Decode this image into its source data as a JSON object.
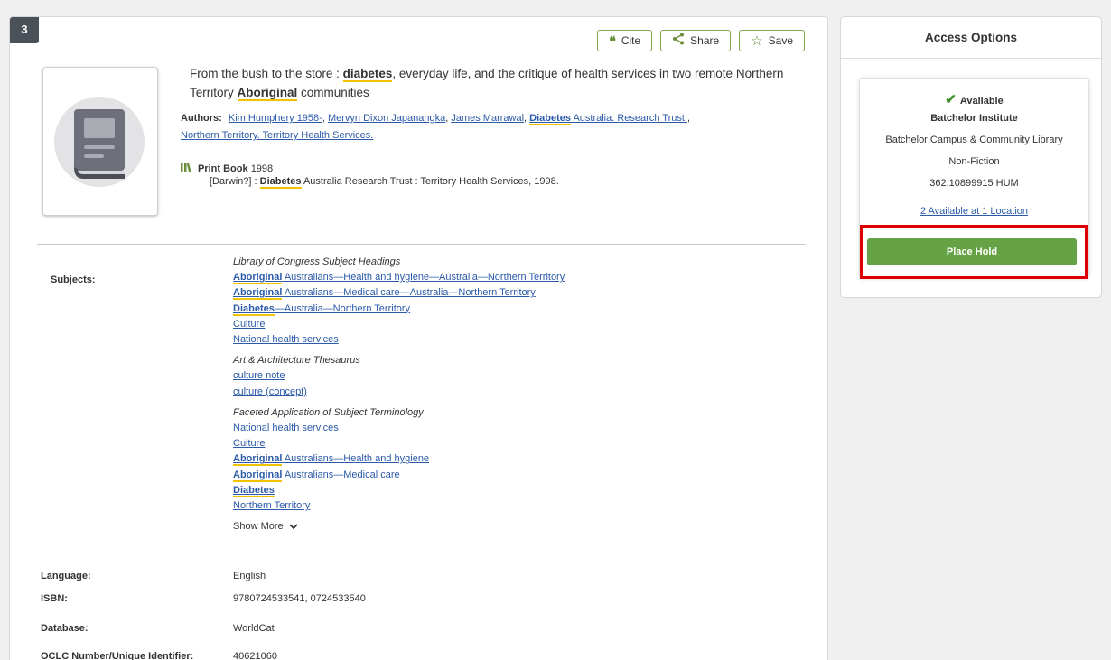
{
  "record": {
    "number": "3",
    "actions": {
      "cite": "Cite",
      "share": "Share",
      "save": "Save"
    },
    "title_parts": [
      "From the bush to the store : ",
      "diabetes",
      ", everyday life, and the critique of health services in two remote Northern Territory ",
      "Aboriginal",
      " communities"
    ],
    "authors_label": "Authors:",
    "authors": [
      "Kim Humphery 1958-",
      "Mervyn Dixon Japanangka",
      "James Marrawal"
    ],
    "author4_hl": "Diabetes",
    "author4_rest": " Australia. Research Trust.",
    "author5": "Northern Territory. Territory Health Services.",
    "format": "Print Book",
    "year": "1998",
    "publisher_pre": "[Darwin?] : ",
    "publisher_hl": "Diabetes",
    "publisher_post": " Australia Research Trust : Territory Health Services, 1998."
  },
  "details": {
    "subjects_label": "Subjects:",
    "lcsh": {
      "heading": "Library of Congress Subject Headings",
      "items": [
        {
          "hl": "Aboriginal",
          "rest": " Australians—Health and hygiene—Australia—Northern Territory"
        },
        {
          "hl": "Aboriginal",
          "rest": " Australians—Medical care—Australia—Northern Territory"
        },
        {
          "hl": "Diabetes",
          "rest": "—Australia—Northern Territory"
        },
        {
          "hl": "",
          "rest": "Culture"
        },
        {
          "hl": "",
          "rest": "National health services"
        }
      ]
    },
    "aat": {
      "heading": "Art & Architecture Thesaurus",
      "items": [
        "culture note",
        "culture (concept)"
      ]
    },
    "fast": {
      "heading": "Faceted Application of Subject Terminology",
      "items": [
        {
          "hl": "",
          "rest": "National health services"
        },
        {
          "hl": "",
          "rest": "Culture"
        },
        {
          "hl": "Aboriginal",
          "rest": " Australians—Health and hygiene"
        },
        {
          "hl": "Aboriginal",
          "rest": " Australians—Medical care"
        },
        {
          "hl": "Diabetes",
          "rest": ""
        },
        {
          "hl": "",
          "rest": "Northern Territory"
        }
      ]
    },
    "show_more": "Show More",
    "language_label": "Language:",
    "language": "English",
    "isbn_label": "ISBN:",
    "isbn": "9780724533541, 0724533540",
    "database_label": "Database:",
    "database": "WorldCat",
    "oclc_label": "OCLC Number/Unique Identifier:",
    "oclc": "40621060"
  },
  "access": {
    "title": "Access Options",
    "status": "Available",
    "institution": "Batchelor Institute",
    "branch": "Batchelor Campus & Community Library",
    "collection": "Non-Fiction",
    "call_number": "362.10899915 HUM",
    "availability_link": "2 Available at 1 Location",
    "place_hold": "Place Hold"
  },
  "icons": {
    "cite": "quote-icon",
    "share": "share-icon",
    "save": "star-outline-icon",
    "format": "book-stack-icon",
    "available": "checkmark-icon",
    "show_more": "chevron-down-icon",
    "cover": "book-placeholder-icon"
  },
  "colors": {
    "accent_green": "#66a344",
    "link_blue": "#2b5aa8",
    "highlight_yellow": "#f2c200",
    "focus_red": "#e00000"
  }
}
